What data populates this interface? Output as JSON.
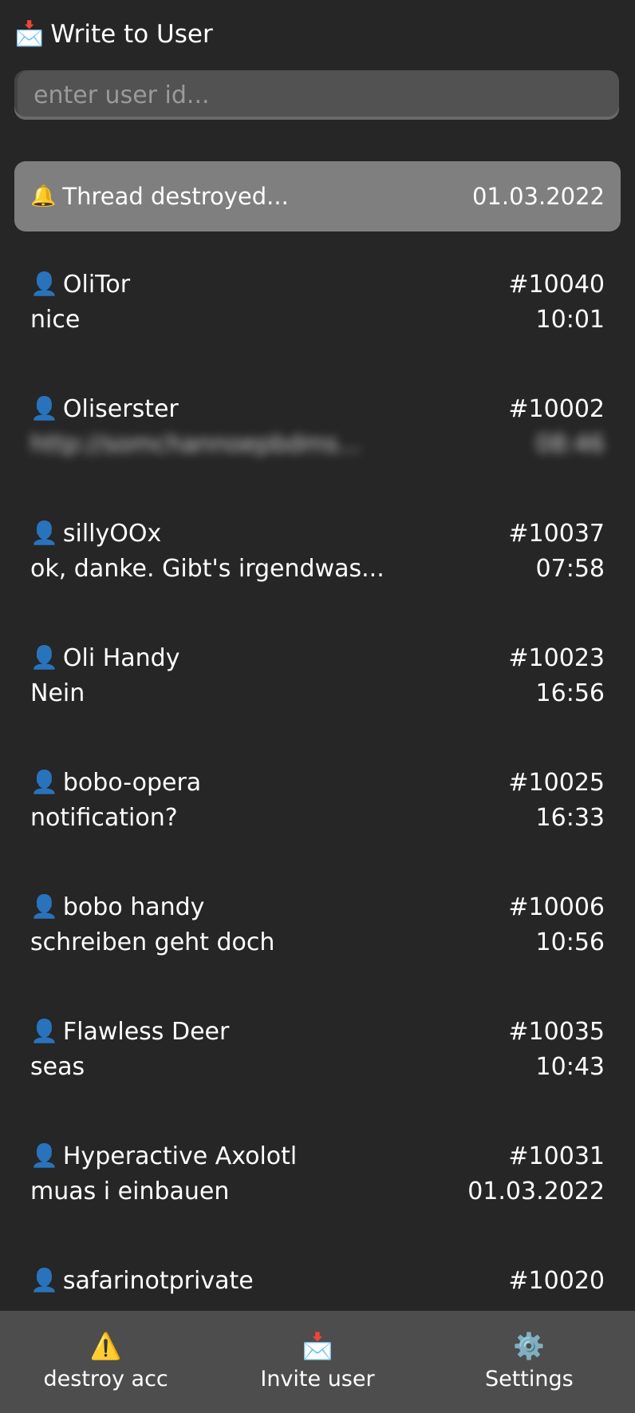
{
  "header": {
    "icon": "incoming-envelope-icon",
    "emoji": "📩",
    "title": "Write to User"
  },
  "search": {
    "placeholder": "enter user id...",
    "value": ""
  },
  "notice": {
    "icon": "bell-icon",
    "emoji": "🔔",
    "text": "Thread destroyed...",
    "date": "01.03.2022"
  },
  "threads": [
    {
      "icon": "user-icon",
      "emoji": "👤",
      "name": "OliTor",
      "id": "#10040",
      "message": "nice",
      "time": "10:01",
      "blurred": false
    },
    {
      "icon": "user-icon",
      "emoji": "👤",
      "name": "Oliserster",
      "id": "#10002",
      "message": "http://somchannoepbdms...",
      "time": "08:46",
      "blurred": true
    },
    {
      "icon": "user-icon",
      "emoji": "👤",
      "name": "sillyOOx",
      "id": "#10037",
      "message": "ok, danke. Gibt's irgendwas...",
      "time": "07:58",
      "blurred": false
    },
    {
      "icon": "user-icon",
      "emoji": "👤",
      "name": "Oli Handy",
      "id": "#10023",
      "message": "Nein",
      "time": "16:56",
      "blurred": false
    },
    {
      "icon": "user-icon",
      "emoji": "👤",
      "name": "bobo-opera",
      "id": "#10025",
      "message": "notification?",
      "time": "16:33",
      "blurred": false
    },
    {
      "icon": "user-icon",
      "emoji": "👤",
      "name": "bobo handy",
      "id": "#10006",
      "message": "schreiben geht doch",
      "time": "10:56",
      "blurred": false
    },
    {
      "icon": "user-icon",
      "emoji": "👤",
      "name": "Flawless Deer",
      "id": "#10035",
      "message": "seas",
      "time": "10:43",
      "blurred": false
    },
    {
      "icon": "user-icon",
      "emoji": "👤",
      "name": "Hyperactive Axolotl",
      "id": "#10031",
      "message": "muas i einbauen",
      "time": "01.03.2022",
      "blurred": false
    },
    {
      "icon": "user-icon",
      "emoji": "👤",
      "name": "safarinotprivate",
      "id": "#10020",
      "message": "",
      "time": "",
      "blurred": false
    }
  ],
  "bottom_nav": [
    {
      "icon": "warning-icon",
      "emoji": "⚠️",
      "label": "destroy acc"
    },
    {
      "icon": "incoming-envelope-icon",
      "emoji": "📩",
      "label": "Invite user"
    },
    {
      "icon": "gear-icon",
      "emoji": "⚙️",
      "label": "Settings"
    }
  ],
  "colors": {
    "background": "#262626",
    "notice": "#7f7f7f",
    "bottom_bar": "#4d4d4d",
    "input": "#525252"
  }
}
